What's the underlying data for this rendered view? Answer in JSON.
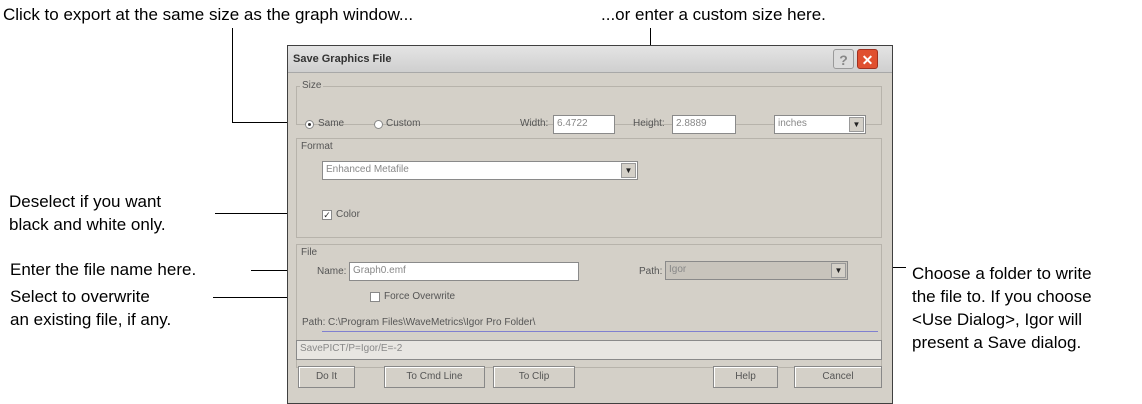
{
  "callouts": {
    "top_left": "Click to export at the same size as the graph window...",
    "top_right": "...or enter a custom size here.",
    "color_line1": "Deselect if you want",
    "color_line2": "black and white only.",
    "name": "Enter the file name here.",
    "overwrite_line1": "Select to overwrite",
    "overwrite_line2": "an existing file, if any.",
    "path_line1": "Choose a folder to write",
    "path_line2": "the file to. If you choose",
    "path_line3": "<Use Dialog>, Igor will",
    "path_line4": "present a Save dialog."
  },
  "dialog": {
    "title": "Save Graphics File",
    "help_icon": "?",
    "close_icon": "✕",
    "size": {
      "group_label": "Size",
      "same_label": "Same",
      "custom_label": "Custom",
      "selected": "Same",
      "width_label": "Width:",
      "width_value": "6.4722",
      "height_label": "Height:",
      "height_value": "2.8889",
      "units_value": "inches"
    },
    "format": {
      "group_label": "Format",
      "value": "Enhanced Metafile",
      "color_label": "Color",
      "color_checked": true
    },
    "file": {
      "group_label": "File",
      "name_label": "Name:",
      "name_value": "Graph0.emf",
      "path_label": "Path:",
      "path_value": "Igor",
      "force_overwrite_label": "Force Overwrite",
      "force_overwrite_checked": false,
      "full_path_label": "Path:",
      "full_path_value": "C:\\Program Files\\WaveMetrics\\Igor Pro Folder\\"
    },
    "command": "SavePICT/P=Igor/E=-2",
    "buttons": {
      "do_it": "Do It",
      "to_cmd_line": "To Cmd Line",
      "to_clip": "To Clip",
      "help": "Help",
      "cancel": "Cancel"
    }
  }
}
